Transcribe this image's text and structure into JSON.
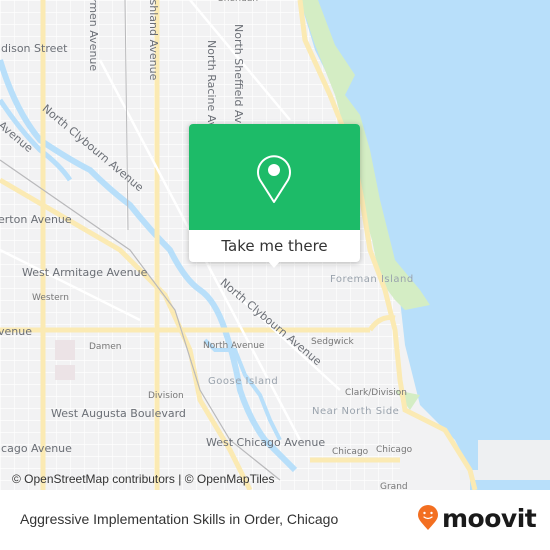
{
  "map": {
    "colors": {
      "land": "#f2f2f3",
      "water": "#b8dffa",
      "park": "#d4edc4",
      "major_road": "#fbeab3",
      "popup_green": "#1dbb68"
    },
    "street_labels": [
      {
        "text": "ldison Street",
        "type": "street"
      },
      {
        "text": "rmen Avenue",
        "type": "street"
      },
      {
        "text": "Ashland Avenue",
        "type": "street"
      },
      {
        "text": "North Racine Avenue",
        "type": "street"
      },
      {
        "text": "North Sheffield Avenue",
        "type": "street"
      },
      {
        "text": "n Avenue",
        "type": "street"
      },
      {
        "text": "North Clybourn Avenue",
        "type": "street"
      },
      {
        "text": "erton Avenue",
        "type": "street"
      },
      {
        "text": "West Armitage Avenue",
        "type": "street"
      },
      {
        "text": "venue",
        "type": "street"
      },
      {
        "text": "North Clybourn Avenue",
        "type": "street"
      },
      {
        "text": "West Augusta Boulevard",
        "type": "street"
      },
      {
        "text": "icago Avenue",
        "type": "street"
      },
      {
        "text": "West Chicago Avenue",
        "type": "street"
      }
    ],
    "station_labels": [
      "Sheridan",
      "Western",
      "Damen",
      "North Avenue",
      "Sedgwick",
      "Division",
      "Clark/Division",
      "Chicago",
      "Chicago",
      "Grand"
    ],
    "area_labels": [
      "Foreman Island",
      "Goose Island",
      "Near North Side"
    ],
    "attribution": "© OpenStreetMap contributors | © OpenMapTiles"
  },
  "popup": {
    "icon": "location-pin-icon",
    "button_label": "Take me there"
  },
  "footer": {
    "title": "Aggressive Implementation Skills in Order, Chicago",
    "brand": "moovit",
    "brand_color": "#f36f21"
  }
}
